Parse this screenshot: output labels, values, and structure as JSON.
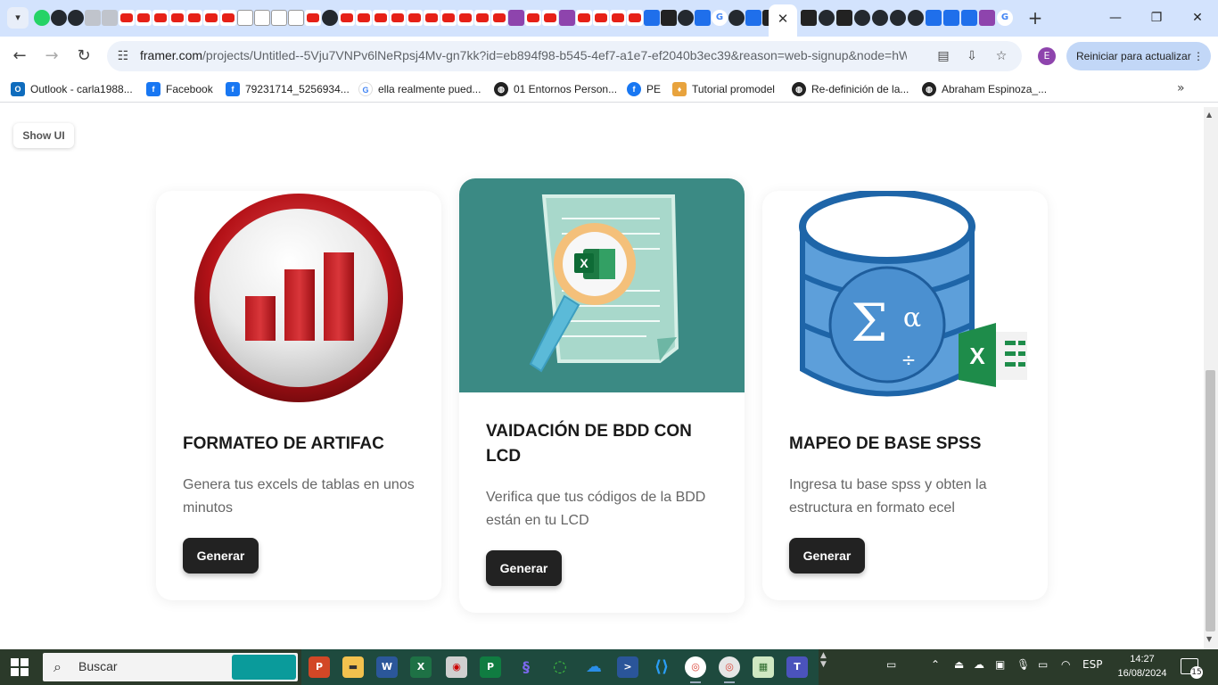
{
  "browser": {
    "active_tab_close": "✕",
    "new_tab": "+",
    "window_controls": {
      "minimize": "—",
      "restore": "❐",
      "close": "✕"
    },
    "url_host": "framer.com",
    "url_path": "/projects/Untitled--5Vju7VNPv6lNeRpsj4Mv-gn7kk?id=eb894f98-b545-4ef7-a1e7-ef2040b3ec39&reason=web-signup&node=hW...",
    "profile_initial": "E",
    "update_button": "Reiniciar para actualizar",
    "update_menu": "⋮"
  },
  "bookmarks": [
    {
      "label": "Outlook - carla1988...",
      "icon": "outlook-icon",
      "color": "#0f6cbd",
      "glyph": "O"
    },
    {
      "label": "Facebook",
      "icon": "facebook-icon",
      "color": "#1877f2",
      "glyph": "f"
    },
    {
      "label": "79231714_5256934...",
      "icon": "facebook-icon",
      "color": "#1877f2",
      "glyph": "f"
    },
    {
      "label": "ella realmente pued...",
      "icon": "google-icon",
      "color": "#ffffff",
      "glyph": "G"
    },
    {
      "label": "01 Entornos Person...",
      "icon": "globe-icon",
      "color": "#222222",
      "glyph": "◍"
    },
    {
      "label": "PE",
      "icon": "facebook-icon",
      "color": "#1877f2",
      "glyph": "f"
    },
    {
      "label": "Tutorial promodel",
      "icon": "promodel-icon",
      "color": "#e8a33d",
      "glyph": "♦"
    },
    {
      "label": "Re-definición de la...",
      "icon": "globe-icon",
      "color": "#222222",
      "glyph": "◍"
    },
    {
      "label": "Abraham Espinoza_...",
      "icon": "globe-icon",
      "color": "#222222",
      "glyph": "◍"
    }
  ],
  "bookmarks_more": "»",
  "canvas": {
    "show_ui": "Show UI"
  },
  "cards": [
    {
      "title": "FORMATEO DE ARTIFAC",
      "description": "Genera tus excels de tablas en unos minutos",
      "button": "Generar"
    },
    {
      "title": "VAIDACIÓN DE BDD  CON LCD",
      "description": "Verifica que tus códigos de la BDD están en tu LCD",
      "button": "Generar",
      "media_color": "#3b8a84"
    },
    {
      "title": "MAPEO DE BASE SPSS",
      "description": "Ingresa tu base spss y obten la estructura en formato ecel",
      "button": "Generar"
    }
  ],
  "taskbar": {
    "search_placeholder": "Buscar",
    "language": "ESP",
    "time": "14:27",
    "date": "16/08/2024",
    "notifications": "15"
  }
}
